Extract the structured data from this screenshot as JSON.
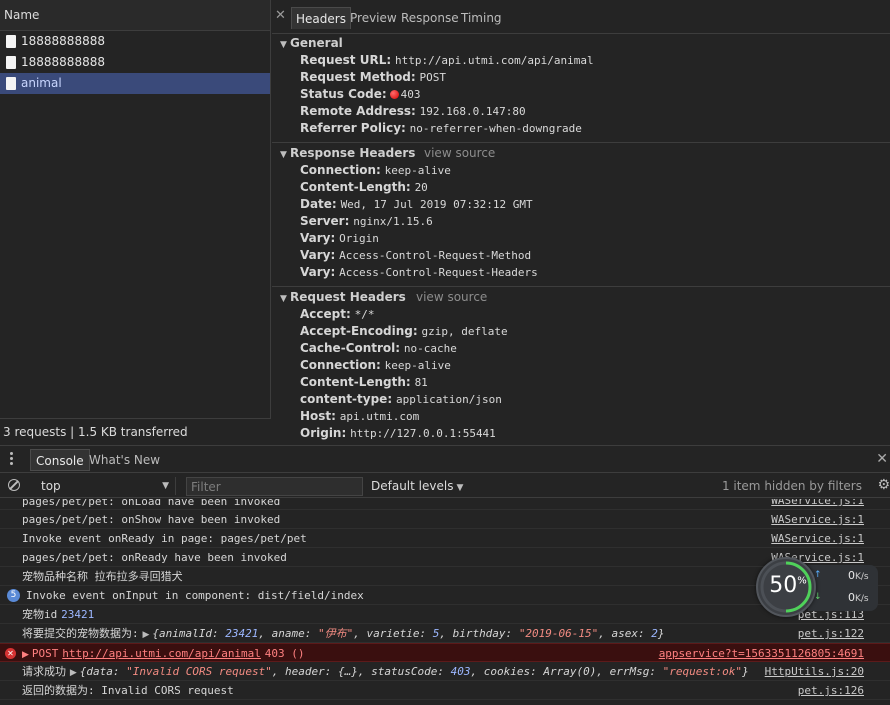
{
  "network": {
    "name_header": "Name",
    "requests": [
      {
        "name": "18888888888",
        "selected": false
      },
      {
        "name": "18888888888",
        "selected": false
      },
      {
        "name": "animal",
        "selected": true
      }
    ],
    "status": "3 requests  |  1.5 KB transferred"
  },
  "details": {
    "tabs": [
      "Headers",
      "Preview",
      "Response",
      "Timing"
    ],
    "active_tab": "Headers",
    "general": {
      "title": "General",
      "rows": [
        {
          "k": "Request URL:",
          "v": "http://api.utmi.com/api/animal"
        },
        {
          "k": "Request Method:",
          "v": "POST"
        },
        {
          "k": "Status Code:",
          "v": "403"
        },
        {
          "k": "Remote Address:",
          "v": "192.168.0.147:80"
        },
        {
          "k": "Referrer Policy:",
          "v": "no-referrer-when-downgrade"
        }
      ]
    },
    "response_headers": {
      "title": "Response Headers",
      "view_source": "view source",
      "rows": [
        {
          "k": "Connection:",
          "v": "keep-alive"
        },
        {
          "k": "Content-Length:",
          "v": "20"
        },
        {
          "k": "Date:",
          "v": "Wed, 17 Jul 2019 07:32:12 GMT"
        },
        {
          "k": "Server:",
          "v": "nginx/1.15.6"
        },
        {
          "k": "Vary:",
          "v": "Origin"
        },
        {
          "k": "Vary:",
          "v": "Access-Control-Request-Method"
        },
        {
          "k": "Vary:",
          "v": "Access-Control-Request-Headers"
        }
      ]
    },
    "request_headers": {
      "title": "Request Headers",
      "view_source": "view source",
      "rows": [
        {
          "k": "Accept:",
          "v": "*/*"
        },
        {
          "k": "Accept-Encoding:",
          "v": "gzip, deflate"
        },
        {
          "k": "Cache-Control:",
          "v": "no-cache"
        },
        {
          "k": "Connection:",
          "v": "keep-alive"
        },
        {
          "k": "Content-Length:",
          "v": "81"
        },
        {
          "k": "content-type:",
          "v": "application/json"
        },
        {
          "k": "Host:",
          "v": "api.utmi.com"
        },
        {
          "k": "Origin:",
          "v": "http://127.0.0.1:55441"
        }
      ]
    }
  },
  "console": {
    "tabs": [
      "Console",
      "What's New"
    ],
    "active_tab": "Console",
    "context": "top",
    "filter_placeholder": "Filter",
    "levels": "Default levels",
    "hidden": "1 item hidden by filters",
    "logs": [
      {
        "text": "pages/pet/pet: onLoad have been invoked",
        "src": "WAService.js:1"
      },
      {
        "text": "pages/pet/pet: onShow have been invoked",
        "src": "WAService.js:1"
      },
      {
        "text": "Invoke event onReady in page: pages/pet/pet",
        "src": "WAService.js:1"
      },
      {
        "text": "pages/pet/pet: onReady have been invoked",
        "src": "WAService.js:1"
      },
      {
        "text": "宠物品种名称 拉布拉多寻回猎犬",
        "src": ""
      },
      {
        "count": "5",
        "text": "Invoke event onInput in component: dist/field/index",
        "src": ""
      },
      {
        "text": "宠物id",
        "value": "23421",
        "src": "pet.js:113"
      },
      {
        "text": "将要提交的宠物数据为:",
        "object": {
          "prefix": "{animalId: ",
          "animalId": "23421",
          "mid1": ", aname: ",
          "aname": "\"伊布\"",
          "mid2": ", varietie: ",
          "varietie": "5",
          "mid3": ", birthday: ",
          "birthday": "\"2019-06-15\"",
          "mid4": ", asex: ",
          "asex": "2",
          "suffix": "}"
        },
        "src": "pet.js:122"
      },
      {
        "error": true,
        "method": "POST",
        "url": "http://api.utmi.com/api/animal",
        "status": "403 ()",
        "src": "appservice?t=1563351126805:4691"
      },
      {
        "text": "请求成功",
        "object2": {
          "p1": "{data: ",
          "data": "\"Invalid CORS request\"",
          "p2": ", header: {…}, statusCode: ",
          "statusCode": "403",
          "p3": ", cookies: ",
          "cookies": "Array(0)",
          "p4": ", errMsg: ",
          "errMsg": "\"request:ok\"",
          "p5": "}"
        },
        "src": "HttpUtils.js:20"
      },
      {
        "text": "返回的数据为:  Invalid CORS request",
        "src": "pet.js:126"
      }
    ]
  },
  "speed_widget": {
    "percent": "50",
    "percent_sign": "%",
    "percent_value": 0.5,
    "up": "0",
    "down": "0",
    "unit": "K/s"
  }
}
